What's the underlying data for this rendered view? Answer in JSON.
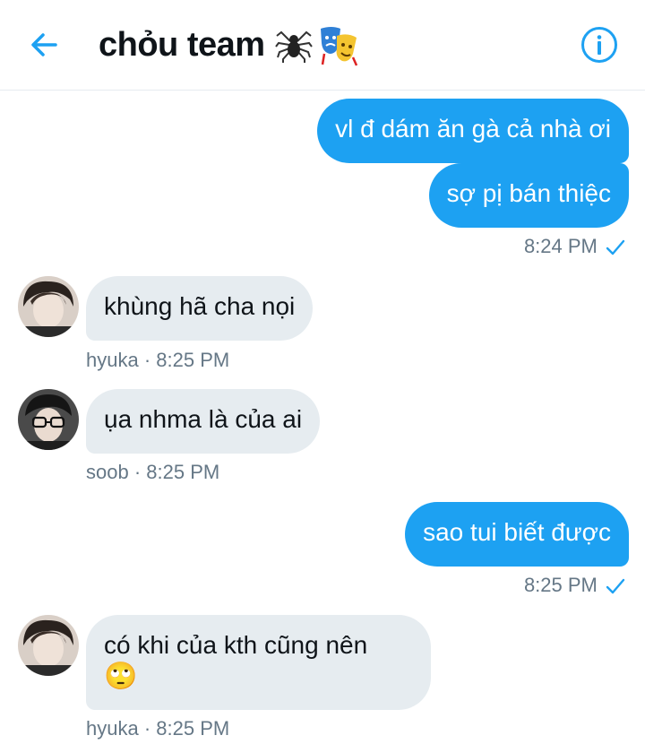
{
  "header": {
    "title": "chỏu team",
    "emojis": [
      "spider-icon",
      "performing-arts-icon"
    ]
  },
  "messages": [
    {
      "direction": "out",
      "text": "vl đ dám ăn gà cả nhà ơi"
    },
    {
      "direction": "out",
      "text": "sợ pị bán thiệc",
      "time": "8:24 PM"
    },
    {
      "direction": "in",
      "sender": "hyuka",
      "text": "khùng hã cha nọi",
      "meta": "hyuka · 8:25 PM"
    },
    {
      "direction": "in",
      "sender": "soob",
      "text": "ụa nhma là của ai",
      "meta": "soob · 8:25 PM"
    },
    {
      "direction": "out",
      "text": "sao tui biết được",
      "time": "8:25 PM"
    },
    {
      "direction": "in",
      "sender": "hyuka",
      "text": "có khi của kth cũng nên",
      "emoji": "🙄",
      "meta": "hyuka · 8:25 PM"
    }
  ],
  "colors": {
    "accent": "#1da1f2",
    "incoming_bubble": "#e6ecf0",
    "meta_text": "#657786"
  }
}
